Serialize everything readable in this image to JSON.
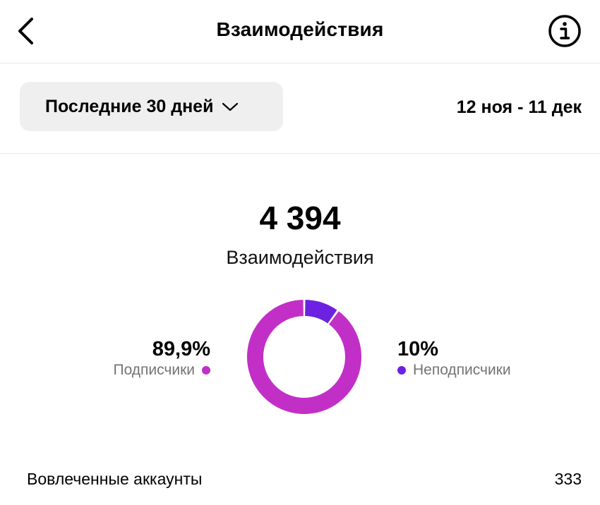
{
  "header": {
    "title": "Взаимодействия",
    "back_icon": "chevron-left-icon",
    "info_icon": "info-icon"
  },
  "filter": {
    "period_label": "Последние 30 дней",
    "dropdown_icon": "chevron-down-icon",
    "date_range": "12 ноя - 11 дек"
  },
  "summary": {
    "total": "4 394",
    "label": "Взаимодействия"
  },
  "chart_data": {
    "type": "pie",
    "categories": [
      "Подписчики",
      "Неподписчики"
    ],
    "values": [
      89.9,
      10
    ],
    "value_labels": [
      "89,9%",
      "10%"
    ],
    "colors": [
      "#c22fc7",
      "#6c22e0"
    ]
  },
  "segments": {
    "followers": {
      "percent": "89,9%",
      "label": "Подписчики",
      "color": "#c22fc7"
    },
    "non_followers": {
      "percent": "10%",
      "label": "Неподписчики",
      "color": "#6c22e0"
    }
  },
  "metrics": {
    "engaged_accounts": {
      "label": "Вовлеченные аккаунты",
      "value": "333"
    }
  }
}
